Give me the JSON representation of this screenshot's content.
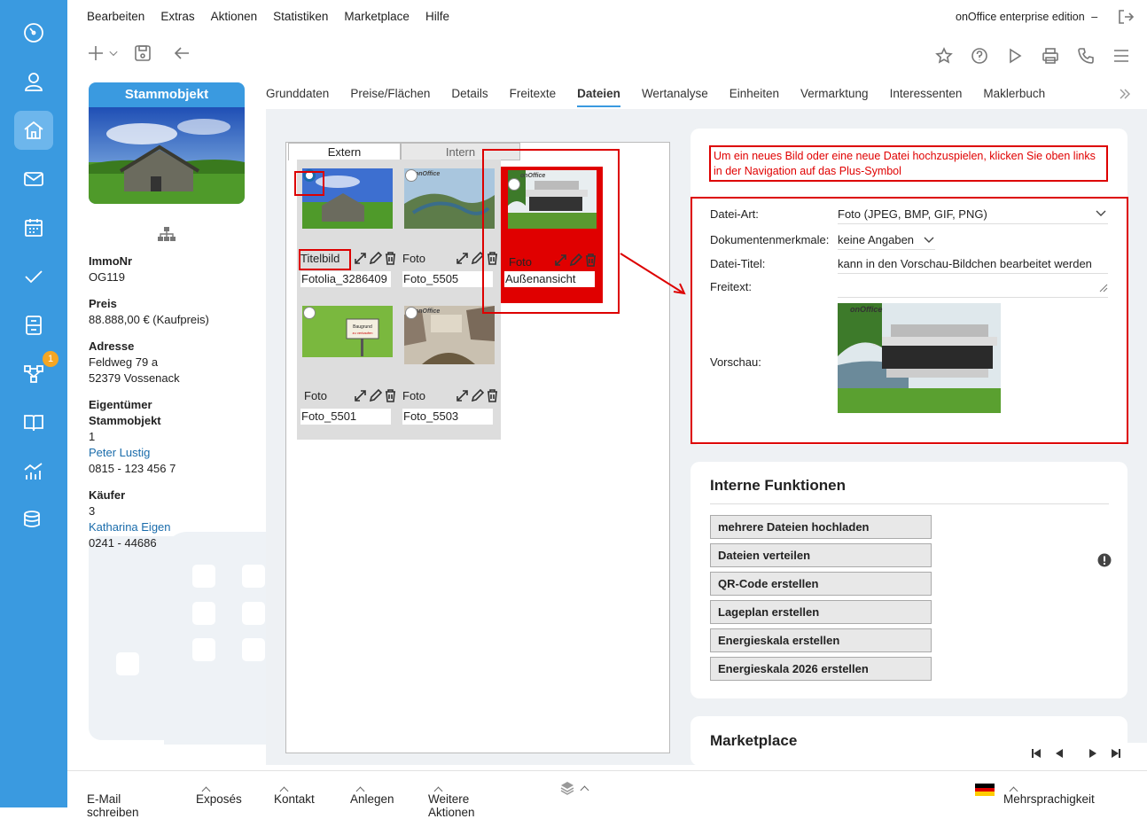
{
  "menu": [
    "Bearbeiten",
    "Extras",
    "Aktionen",
    "Statistiken",
    "Marketplace",
    "Hilfe"
  ],
  "edition": "onOffice enterprise edition",
  "edition_sep": "–",
  "sidebar": {
    "badge": "1"
  },
  "record": {
    "title": "Stammobjekt"
  },
  "info": {
    "immonr_label": "ImmoNr",
    "immonr": "OG119",
    "preis_label": "Preis",
    "preis": "88.888,00 € (Kaufpreis)",
    "adresse_label": "Adresse",
    "adresse1": "Feldweg 79 a",
    "adresse2": "52379 Vossenack",
    "eig_label1": "Eigentümer",
    "eig_label2": "Stammobjekt",
    "eig_count": "1",
    "eig_name": "Peter Lustig",
    "eig_phone": "0815 - 123 456 7",
    "kaeufer_label": "Käufer",
    "kaeufer_count": "3",
    "kaeufer_name": "Katharina Eigen",
    "kaeufer_phone": "0241 - 44686"
  },
  "tabs": [
    "Grunddaten",
    "Preise/Flächen",
    "Details",
    "Freitexte",
    "Dateien",
    "Wertanalyse",
    "Einheiten",
    "Vermarktung",
    "Interessenten",
    "Maklerbuch"
  ],
  "filetabs": {
    "extern": "Extern",
    "intern": "Intern"
  },
  "files": [
    {
      "label": "Titelbild",
      "caption": "Fotolia_3286409"
    },
    {
      "label": "Foto",
      "caption": "Foto_5505"
    },
    {
      "label": "Foto",
      "caption": "Außenansicht"
    },
    {
      "label": "Foto",
      "caption": "Foto_5501"
    },
    {
      "label": "Foto",
      "caption": "Foto_5503"
    }
  ],
  "watermark": "onOffice",
  "sign": {
    "line1": "Baugrund",
    "line2": "zu verkaufen"
  },
  "notice": "Um ein neues Bild oder eine neue Datei hochzuspielen, klicken Sie oben links in der Navigation auf das Plus-Symbol",
  "form": {
    "art_label": "Datei-Art:",
    "art_value": "Foto (JPEG, BMP, GIF, PNG)",
    "merk_label": "Dokumentenmerkmale:",
    "merk_value": "keine Angaben",
    "titel_label": "Datei-Titel:",
    "titel_value": "kann in den Vorschau-Bildchen bearbeitet werden",
    "freitext_label": "Freitext:",
    "vorschau_label": "Vorschau:"
  },
  "intern": {
    "title": "Interne Funktionen",
    "buttons": [
      "mehrere Dateien hochladen",
      "Dateien verteilen",
      "QR-Code erstellen",
      "Lageplan erstellen",
      "Energieskala erstellen",
      "Energieskala 2026 erstellen"
    ]
  },
  "next_section": "Marketplace",
  "bottom": {
    "email": "E-Mail schreiben",
    "exposes": "Exposés",
    "kontakt": "Kontakt",
    "anlegen": "Anlegen",
    "weitere": "Weitere Aktionen",
    "lang": "Mehrsprachigkeit"
  },
  "colors": {
    "accent": "#3a9ae0",
    "highlight": "#e00000"
  }
}
